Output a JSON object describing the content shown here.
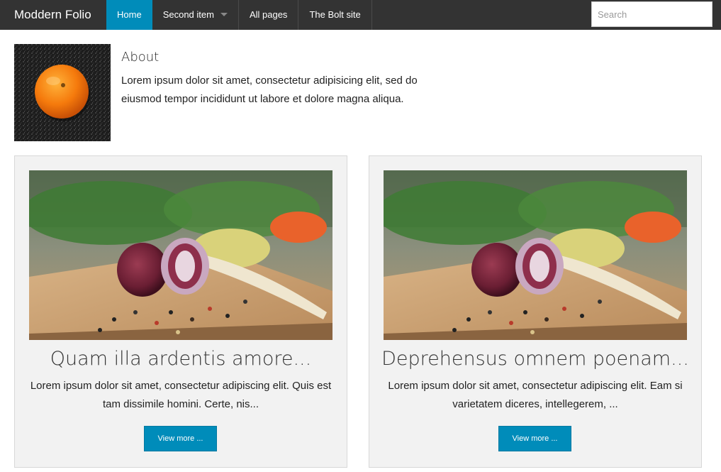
{
  "site": {
    "brand": "Moddern Folio"
  },
  "nav": {
    "items": [
      {
        "label": "Home",
        "active": true
      },
      {
        "label": "Second item",
        "dropdown": true
      },
      {
        "label": "All pages"
      },
      {
        "label": "The Bolt site"
      }
    ]
  },
  "search": {
    "placeholder": "Search",
    "value": ""
  },
  "about": {
    "title": "About",
    "text": "Lorem ipsum dolor sit amet, consectetur adipisicing elit, sed do eiusmod tempor incididunt ut labore et dolore magna aliqua."
  },
  "cards": [
    {
      "title": "Quam illa ardentis amore...",
      "text": "Lorem ipsum dolor sit amet, consectetur adipiscing elit. Quis est tam dissimile homini. Certe, nis...",
      "button": "View more ..."
    },
    {
      "title": "Deprehensus omnem poenam...",
      "text": "Lorem ipsum dolor sit amet, consectetur adipiscing elit. Eam si varietatem diceres, intellegerem, ...",
      "button": "View more ..."
    }
  ],
  "colors": {
    "topbar": "#333333",
    "accent": "#008cba",
    "card_bg": "#f2f2f2"
  }
}
